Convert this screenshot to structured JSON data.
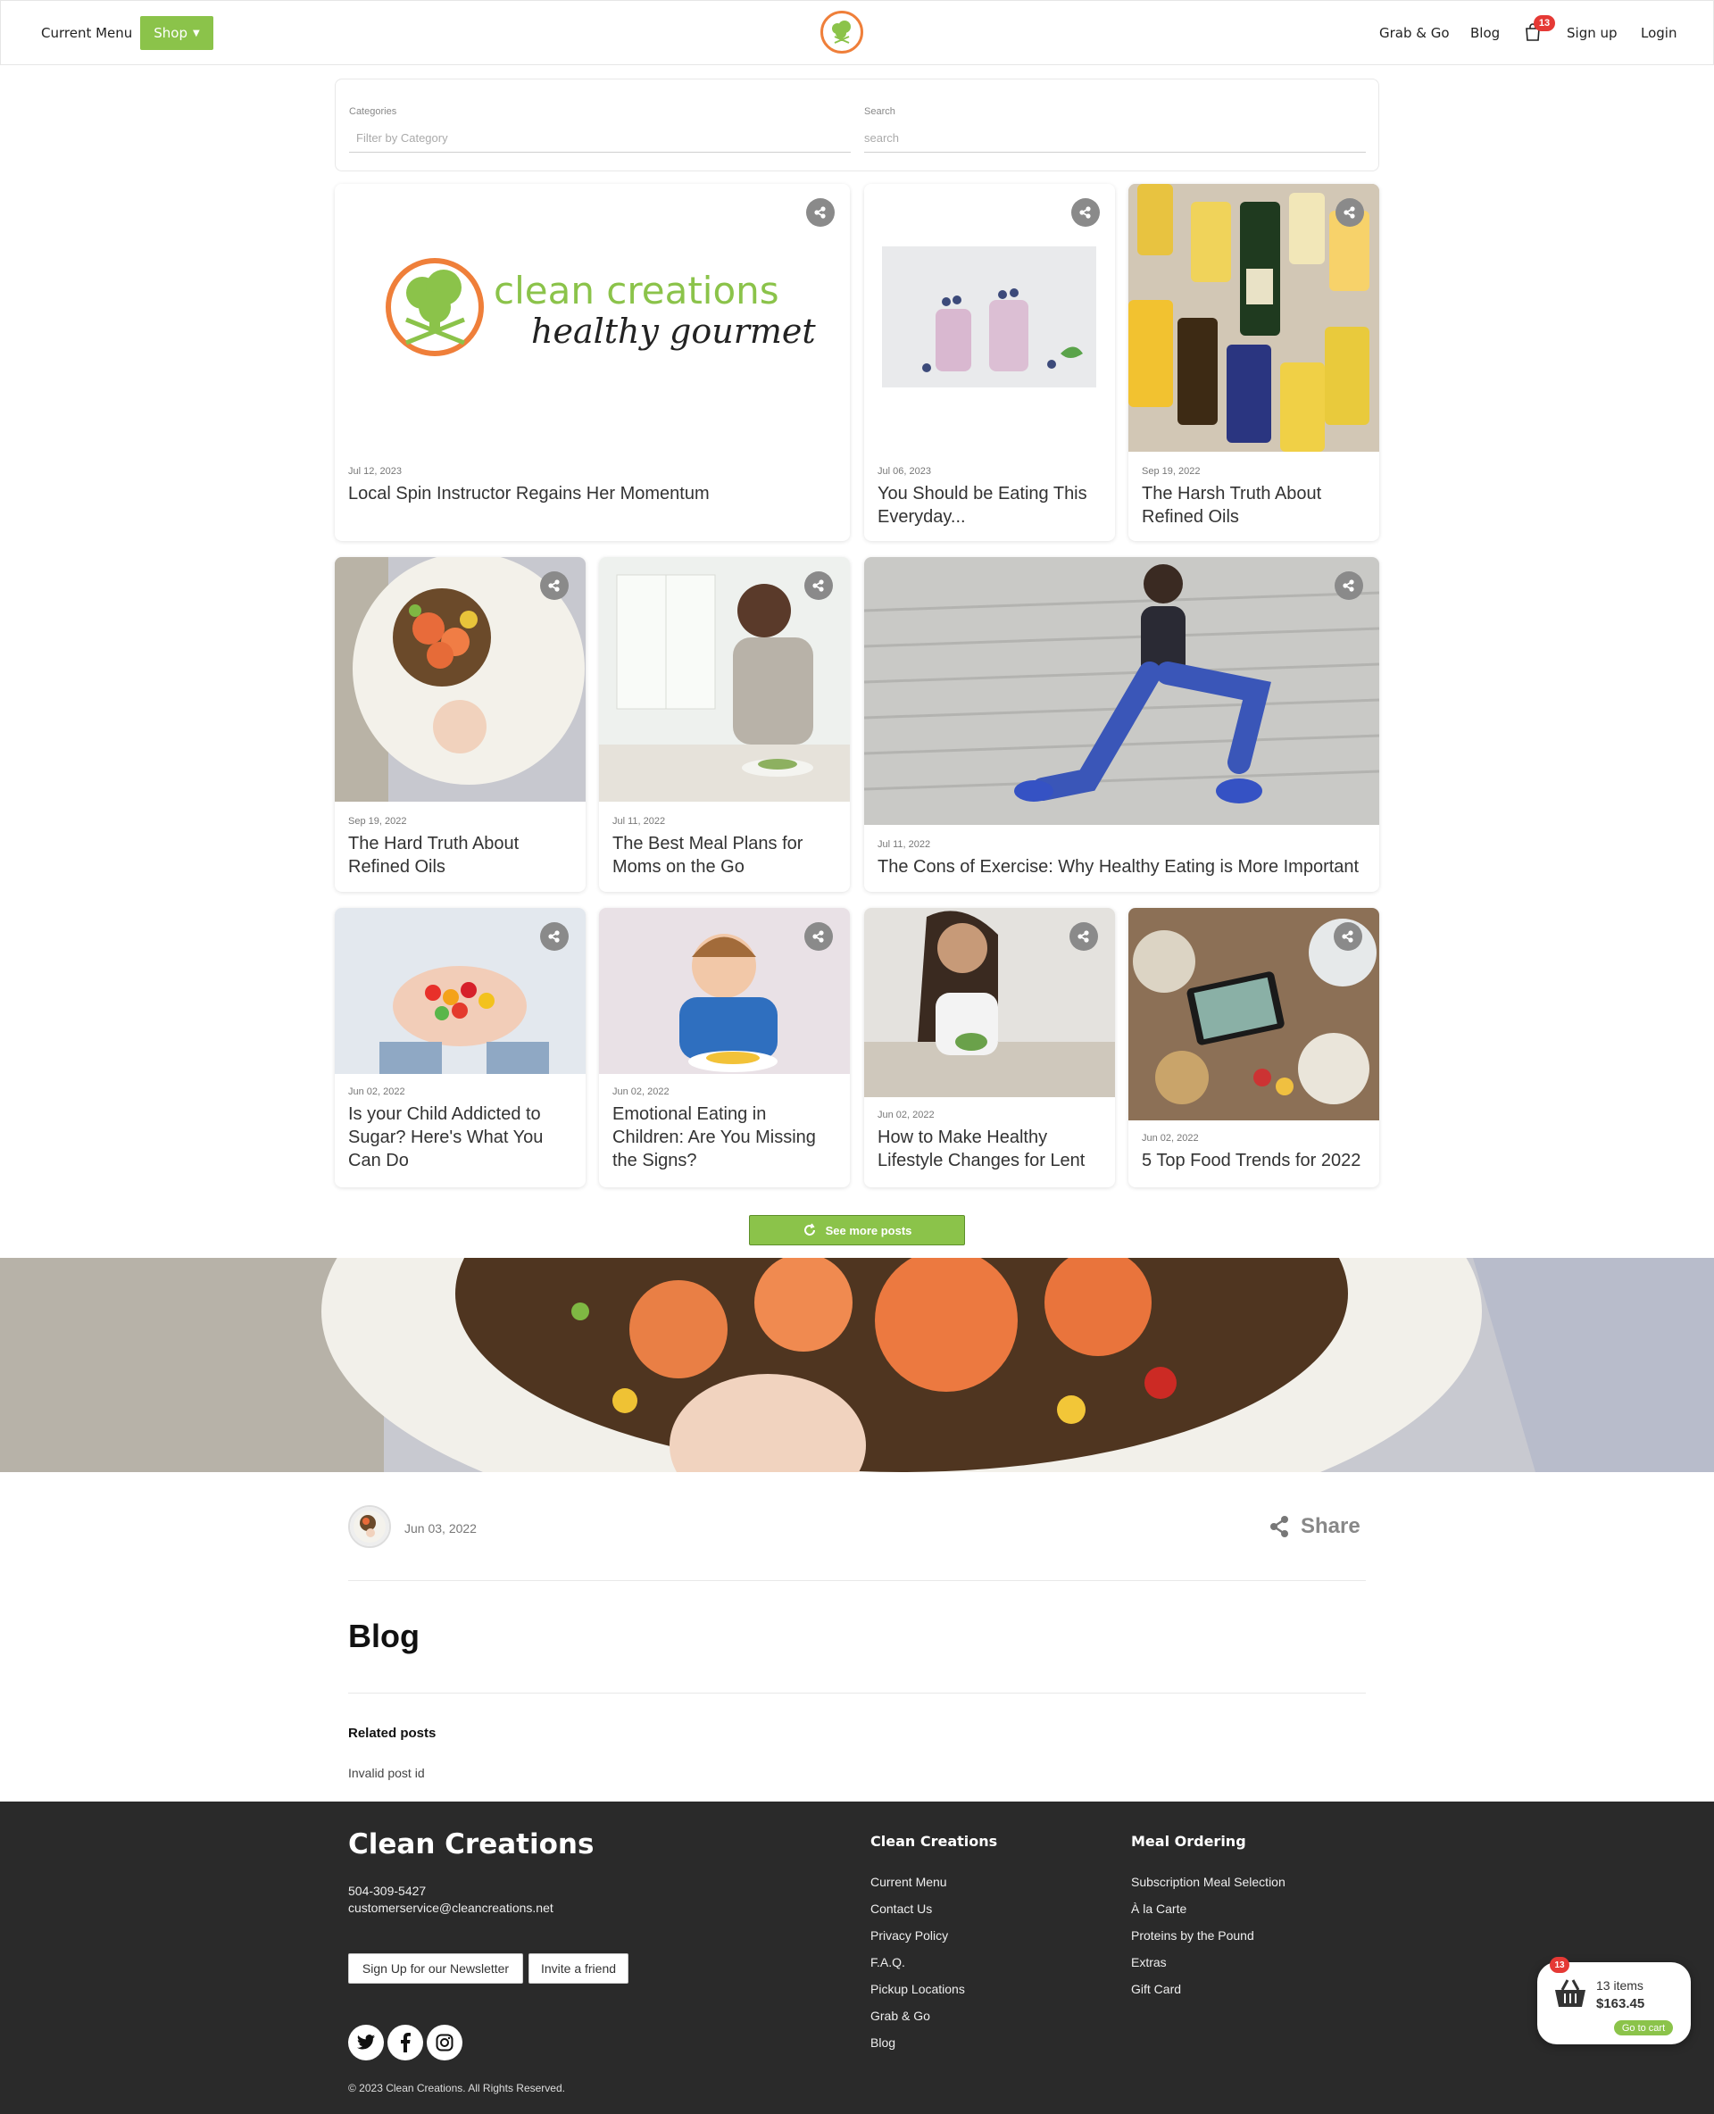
{
  "header": {
    "left_links": [
      "Current Menu"
    ],
    "shop_label": "Shop",
    "right_links": [
      "Grab & Go",
      "Blog"
    ],
    "cart_count": "13",
    "signup_label": "Sign up",
    "login_label": "Login",
    "brand_color": "#8bc34a",
    "accent_color": "#ef7f3a"
  },
  "filters": {
    "categories_label": "Categories",
    "categories_placeholder": "Filter by Category",
    "search_label": "Search",
    "search_placeholder": "search"
  },
  "posts": [
    {
      "date": "Jul 12, 2023",
      "title": "Local Spin Instructor Regains Her Momentum",
      "logo_line1": "clean creations",
      "logo_line2": "healthy gourmet"
    },
    {
      "date": "Jul 06, 2023",
      "title": "You Should be Eating This Everyday..."
    },
    {
      "date": "Sep 19, 2022",
      "title": "The Harsh Truth About Refined Oils"
    },
    {
      "date": "Sep 19, 2022",
      "title": "The Hard Truth About Refined Oils"
    },
    {
      "date": "Jul 11, 2022",
      "title": "The Best Meal Plans for Moms on the Go"
    },
    {
      "date": "Jul 11, 2022",
      "title": "The Cons of Exercise: Why Healthy Eating is More Important"
    },
    {
      "date": "Jun 02, 2022",
      "title": "Is your Child Addicted to Sugar? Here's What You Can Do"
    },
    {
      "date": "Jun 02, 2022",
      "title": "Emotional Eating in Children: Are You Missing the Signs?"
    },
    {
      "date": "Jun 02, 2022",
      "title": "How to Make Healthy Lifestyle Changes for Lent"
    },
    {
      "date": "Jun 02, 2022",
      "title": "5 Top Food Trends for 2022"
    }
  ],
  "see_more_label": "See more posts",
  "post": {
    "date": "Jun 03, 2022",
    "share_label": "Share",
    "title": "Blog",
    "related_label": "Related posts",
    "related_message": "Invalid post id"
  },
  "footer": {
    "brand": "Clean Creations",
    "phone": "504-309-5427",
    "email": "customerservice@cleancreations.net",
    "newsletter_label": "Sign Up for our Newsletter",
    "invite_label": "Invite a friend",
    "col1_title": "Clean Creations",
    "col1_links": [
      "Current Menu",
      "Contact Us",
      "Privacy Policy",
      "F.A.Q.",
      "Pickup Locations",
      "Grab & Go",
      "Blog"
    ],
    "col2_title": "Meal Ordering",
    "col2_links": [
      "Subscription Meal Selection",
      "À la Carte",
      "Proteins by the Pound",
      "Extras",
      "Gift Card"
    ],
    "copyright": "© 2023 Clean Creations. All Rights Reserved.",
    "background": "#2a2a2a"
  },
  "cart_widget": {
    "badge": "13",
    "items": "13 items",
    "total": "$163.45",
    "go_label": "Go to cart"
  }
}
